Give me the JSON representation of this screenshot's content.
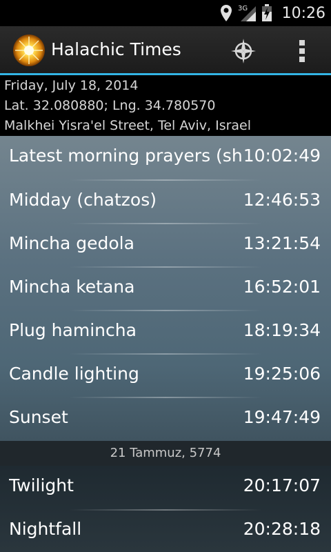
{
  "status_bar": {
    "time": "10:26",
    "network": "3G",
    "icons": [
      "location-icon",
      "signal-icon",
      "battery-icon"
    ]
  },
  "action_bar": {
    "title": "Halachic Times",
    "icons": [
      "sun-icon",
      "compass-icon",
      "overflow-menu-icon"
    ]
  },
  "header": {
    "date": "Friday, July 18, 2014",
    "coordinates": "Lat. 32.080880; Lng. 34.780570",
    "address": "Malkhei Yisra'el Street, Tel Aviv, Israel"
  },
  "times": [
    {
      "label": "Latest morning prayers (shacharis)",
      "time": "10:02:49"
    },
    {
      "label": "Midday (chatzos)",
      "time": "12:46:53"
    },
    {
      "label": "Mincha gedola",
      "time": "13:21:54"
    },
    {
      "label": "Mincha ketana",
      "time": "16:52:01"
    },
    {
      "label": "Plug hamincha",
      "time": "18:19:34"
    },
    {
      "label": "Candle lighting",
      "time": "19:25:06"
    },
    {
      "label": "Sunset",
      "time": "19:47:49"
    }
  ],
  "hebrew_date": "21 Tammuz, 5774",
  "times_after": [
    {
      "label": "Twilight",
      "time": "20:17:07"
    },
    {
      "label": "Nightfall",
      "time": "20:28:18"
    }
  ],
  "colors": {
    "accent": "#33b5e5",
    "background": "#000000"
  }
}
